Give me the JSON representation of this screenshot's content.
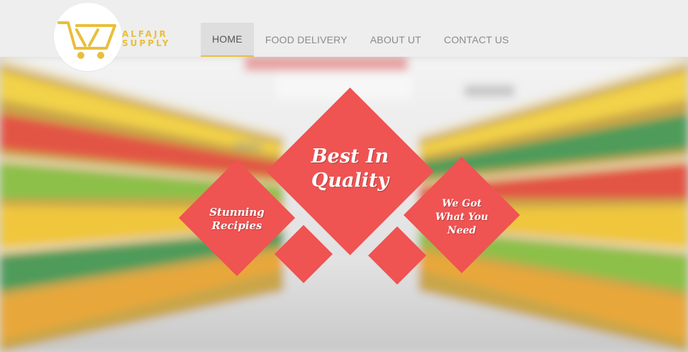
{
  "brand": {
    "line1": "ALFAJR",
    "line2": "SUPPLY",
    "colors": {
      "accent": "#e9bf3a",
      "diamond": "#ef5352",
      "header_bg": "#eeeeee"
    }
  },
  "nav": {
    "items": [
      {
        "label": "HOME",
        "active": true
      },
      {
        "label": "FOOD DELIVERY",
        "active": false
      },
      {
        "label": "ABOUT UT",
        "active": false
      },
      {
        "label": "CONTACT US",
        "active": false
      }
    ]
  },
  "hero": {
    "center_title_line1": "Best In",
    "center_title_line2": "Quality",
    "left_title_line1": "Stunning",
    "left_title_line2": "Recipies",
    "right_title_line1": "We Got",
    "right_title_line2": "What You",
    "right_title_line3": "Need"
  }
}
